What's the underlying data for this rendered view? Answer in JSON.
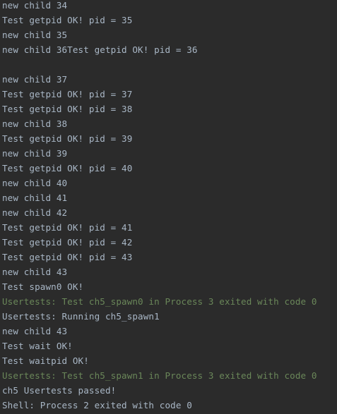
{
  "colors": {
    "background": "#2b2b2b",
    "text": "#a9b7c6",
    "success": "#6a8759"
  },
  "console": {
    "lines": [
      {
        "text": "new child 34",
        "kind": "normal"
      },
      {
        "text": "Test getpid OK! pid = 35",
        "kind": "normal"
      },
      {
        "text": "new child 35",
        "kind": "normal"
      },
      {
        "text": "new child 36Test getpid OK! pid = 36",
        "kind": "normal"
      },
      {
        "text": "",
        "kind": "blank"
      },
      {
        "text": "new child 37",
        "kind": "normal"
      },
      {
        "text": "Test getpid OK! pid = 37",
        "kind": "normal"
      },
      {
        "text": "Test getpid OK! pid = 38",
        "kind": "normal"
      },
      {
        "text": "new child 38",
        "kind": "normal"
      },
      {
        "text": "Test getpid OK! pid = 39",
        "kind": "normal"
      },
      {
        "text": "new child 39",
        "kind": "normal"
      },
      {
        "text": "Test getpid OK! pid = 40",
        "kind": "normal"
      },
      {
        "text": "new child 40",
        "kind": "normal"
      },
      {
        "text": "new child 41",
        "kind": "normal"
      },
      {
        "text": "new child 42",
        "kind": "normal"
      },
      {
        "text": "Test getpid OK! pid = 41",
        "kind": "normal"
      },
      {
        "text": "Test getpid OK! pid = 42",
        "kind": "normal"
      },
      {
        "text": "Test getpid OK! pid = 43",
        "kind": "normal"
      },
      {
        "text": "new child 43",
        "kind": "normal"
      },
      {
        "text": "Test spawn0 OK!",
        "kind": "normal"
      },
      {
        "text": "Usertests: Test ch5_spawn0 in Process 3 exited with code 0",
        "kind": "success"
      },
      {
        "text": "Usertests: Running ch5_spawn1",
        "kind": "normal"
      },
      {
        "text": "new child 43",
        "kind": "normal"
      },
      {
        "text": "Test wait OK!",
        "kind": "normal"
      },
      {
        "text": "Test waitpid OK!",
        "kind": "normal"
      },
      {
        "text": "Usertests: Test ch5_spawn1 in Process 3 exited with code 0",
        "kind": "success"
      },
      {
        "text": "ch5 Usertests passed!",
        "kind": "normal"
      },
      {
        "text": "Shell: Process 2 exited with code 0",
        "kind": "normal"
      }
    ]
  }
}
